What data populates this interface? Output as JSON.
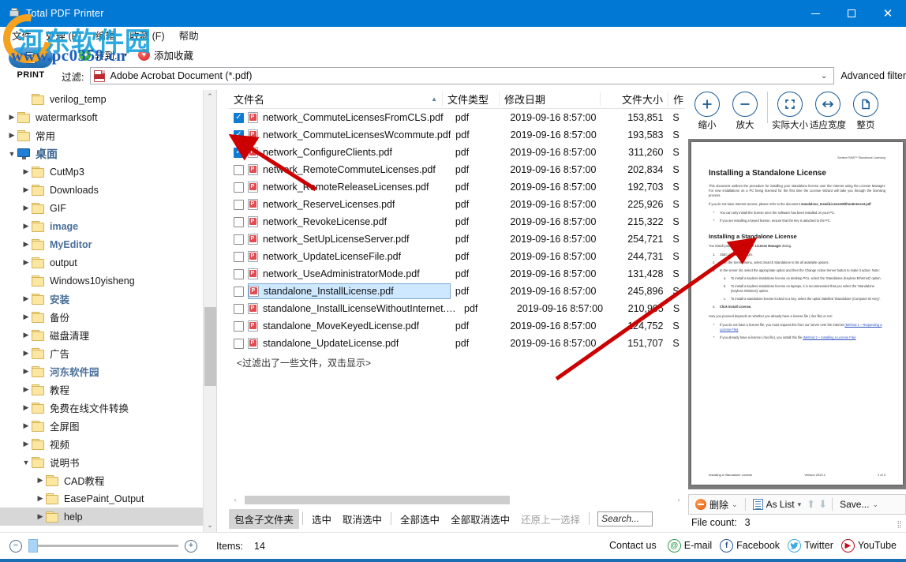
{
  "window": {
    "title": "Total PDF Printer",
    "icon": "printer-icon",
    "minimize": "–",
    "maximize": "□",
    "close": "✕"
  },
  "menubar": {
    "items": [
      {
        "label": "文件"
      },
      {
        "label": "处理 (P)"
      },
      {
        "label": "编辑"
      },
      {
        "label": "收藏 (F)"
      },
      {
        "label": "帮助"
      }
    ]
  },
  "toolbar": {
    "print_label": "PRINT",
    "goto_label": "转到..",
    "goto_caret": "▾",
    "favorite_label": "添加收藏",
    "filter_label": "过滤:",
    "filter_value": "Adobe Acrobat Document (*.pdf)",
    "filter_caret": "⌄",
    "advanced_filter": "Advanced filter"
  },
  "tree": {
    "scroll_up": "⌃",
    "scroll_down": "⌄",
    "items": [
      {
        "label": "verilog_temp",
        "indent": 1,
        "twisty": "",
        "icon": "folder",
        "style": ""
      },
      {
        "label": "watermarksoft",
        "indent": 0,
        "twisty": "▶",
        "icon": "folder",
        "style": ""
      },
      {
        "label": "常用",
        "indent": 0,
        "twisty": "▶",
        "icon": "folder",
        "style": ""
      },
      {
        "label": "桌面",
        "indent": 0,
        "twisty": "▼",
        "icon": "desktop",
        "style": "big"
      },
      {
        "label": "CutMp3",
        "indent": 1,
        "twisty": "▶",
        "icon": "folder",
        "style": ""
      },
      {
        "label": "Downloads",
        "indent": 1,
        "twisty": "▶",
        "icon": "folder",
        "style": ""
      },
      {
        "label": "GIF",
        "indent": 1,
        "twisty": "▶",
        "icon": "folder",
        "style": ""
      },
      {
        "label": "image",
        "indent": 1,
        "twisty": "▶",
        "icon": "folder",
        "style": "blue"
      },
      {
        "label": "MyEditor",
        "indent": 1,
        "twisty": "▶",
        "icon": "folder",
        "style": "blue"
      },
      {
        "label": "output",
        "indent": 1,
        "twisty": "▶",
        "icon": "folder",
        "style": ""
      },
      {
        "label": "Windows10yisheng",
        "indent": 1,
        "twisty": "",
        "icon": "folder",
        "style": ""
      },
      {
        "label": "安装",
        "indent": 1,
        "twisty": "▶",
        "icon": "folder",
        "style": "blue"
      },
      {
        "label": "备份",
        "indent": 1,
        "twisty": "▶",
        "icon": "folder",
        "style": ""
      },
      {
        "label": "磁盘清理",
        "indent": 1,
        "twisty": "▶",
        "icon": "folder",
        "style": ""
      },
      {
        "label": "广告",
        "indent": 1,
        "twisty": "▶",
        "icon": "folder",
        "style": ""
      },
      {
        "label": "河东软件园",
        "indent": 1,
        "twisty": "▶",
        "icon": "folder",
        "style": "blue"
      },
      {
        "label": "教程",
        "indent": 1,
        "twisty": "▶",
        "icon": "folder",
        "style": ""
      },
      {
        "label": "免费在线文件转换",
        "indent": 1,
        "twisty": "▶",
        "icon": "folder",
        "style": ""
      },
      {
        "label": "全屏图",
        "indent": 1,
        "twisty": "▶",
        "icon": "folder",
        "style": ""
      },
      {
        "label": "视频",
        "indent": 1,
        "twisty": "▶",
        "icon": "folder",
        "style": ""
      },
      {
        "label": "说明书",
        "indent": 1,
        "twisty": "▼",
        "icon": "folder",
        "style": ""
      },
      {
        "label": "CAD教程",
        "indent": 2,
        "twisty": "▶",
        "icon": "folder",
        "style": ""
      },
      {
        "label": "EasePaint_Output",
        "indent": 2,
        "twisty": "▶",
        "icon": "folder",
        "style": ""
      },
      {
        "label": "help",
        "indent": 2,
        "twisty": "▶",
        "icon": "folder",
        "style": "",
        "selected": true
      }
    ]
  },
  "filelist": {
    "columns": {
      "name": "文件名",
      "type": "文件类型",
      "date": "修改日期",
      "size": "文件大小",
      "author": "作"
    },
    "sort_indicator": "▲",
    "rows": [
      {
        "checked": true,
        "name": "network_CommuteLicensesFromCLS.pdf",
        "type": "pdf",
        "date": "2019-09-16 8:57:00",
        "size": "153,851",
        "author": "S"
      },
      {
        "checked": true,
        "name": "network_CommuteLicensesWcommute.pdf",
        "type": "pdf",
        "date": "2019-09-16 8:57:00",
        "size": "193,583",
        "author": "S"
      },
      {
        "checked": true,
        "name": "network_ConfigureClients.pdf",
        "type": "pdf",
        "date": "2019-09-16 8:57:00",
        "size": "311,260",
        "author": "S"
      },
      {
        "checked": false,
        "name": "network_RemoteCommuteLicenses.pdf",
        "type": "pdf",
        "date": "2019-09-16 8:57:00",
        "size": "202,834",
        "author": "S"
      },
      {
        "checked": false,
        "name": "network_RemoteReleaseLicenses.pdf",
        "type": "pdf",
        "date": "2019-09-16 8:57:00",
        "size": "192,703",
        "author": "S"
      },
      {
        "checked": false,
        "name": "network_ReserveLicenses.pdf",
        "type": "pdf",
        "date": "2019-09-16 8:57:00",
        "size": "225,926",
        "author": "S"
      },
      {
        "checked": false,
        "name": "network_RevokeLicense.pdf",
        "type": "pdf",
        "date": "2019-09-16 8:57:00",
        "size": "215,322",
        "author": "S"
      },
      {
        "checked": false,
        "name": "network_SetUpLicenseServer.pdf",
        "type": "pdf",
        "date": "2019-09-16 8:57:00",
        "size": "254,721",
        "author": "S"
      },
      {
        "checked": false,
        "name": "network_UpdateLicenseFile.pdf",
        "type": "pdf",
        "date": "2019-09-16 8:57:00",
        "size": "244,731",
        "author": "S"
      },
      {
        "checked": false,
        "name": "network_UseAdministratorMode.pdf",
        "type": "pdf",
        "date": "2019-09-16 8:57:00",
        "size": "131,428",
        "author": "S"
      },
      {
        "checked": false,
        "name": "standalone_InstallLicense.pdf",
        "type": "pdf",
        "date": "2019-09-16 8:57:00",
        "size": "245,896",
        "author": "S",
        "selected": true
      },
      {
        "checked": false,
        "name": "standalone_InstallLicenseWithoutInternet.pdf",
        "type": "pdf",
        "date": "2019-09-16 8:57:00",
        "size": "210,905",
        "author": "S"
      },
      {
        "checked": false,
        "name": "standalone_MoveKeyedLicense.pdf",
        "type": "pdf",
        "date": "2019-09-16 8:57:00",
        "size": "124,752",
        "author": "S"
      },
      {
        "checked": false,
        "name": "standalone_UpdateLicense.pdf",
        "type": "pdf",
        "date": "2019-09-16 8:57:00",
        "size": "151,707",
        "author": "S"
      }
    ],
    "filtered_hint": "<过滤出了一些文件，双击显示>",
    "hscroll_left": "‹",
    "hscroll_right": "›"
  },
  "list_toolbar": {
    "include_subfolders": "包含子文件夹",
    "select": "选中",
    "deselect": "取消选中",
    "select_all": "全部选中",
    "deselect_all": "全部取消选中",
    "restore_prev": "还原上一选择",
    "search_placeholder": "Search..."
  },
  "preview_tools": {
    "buttons": [
      {
        "label": "缩小",
        "icon": "zoom-in-icon",
        "glyph": "+"
      },
      {
        "label": "放大",
        "icon": "zoom-out-icon",
        "glyph": "−"
      },
      {
        "label": "实际大小",
        "icon": "actual-size-icon",
        "glyph": "⛶"
      },
      {
        "label": "适应宽度",
        "icon": "fit-width-icon",
        "glyph": "↔"
      },
      {
        "label": "整页",
        "icon": "fit-page-icon",
        "glyph": "▯"
      }
    ]
  },
  "preview_doc": {
    "header": "Sentinel RMS™ Standalone Licensing",
    "title": "Installing a Standalone License",
    "intro1": "This document outlines the procedure for installing your standalone license over the Internet using the License Manager. For new installations on a PC being licensed for the first time the License Wizard will take you through the licensing process.",
    "intro2_pre": "If you do not have Internet access, please refer to the document ",
    "intro2_bold": "standalone_InstallLicenseWithoutInternet.pdf",
    "bullets": [
      "You can only install the license once the software has been installed on your PC.",
      "If you are installing a keyed license, ensure that the key is attached to the PC."
    ],
    "section2": "Installing a Standalone License",
    "section2_intro_pre": "You install your license from the ",
    "section2_intro_bold": "License Manager",
    "section2_intro_post": " dialog.",
    "steps": [
      {
        "n": "1.",
        "text": "Start License Manager."
      },
      {
        "n": "2.",
        "text": "From the Server menu, select Search Standalone to list all available options."
      },
      {
        "n": "3.",
        "text": "In the server list, select the appropriate option and then the Change Active Server button to make it active. Note:"
      },
      {
        "n": "4.",
        "text": "Click Install License."
      }
    ],
    "substeps": [
      {
        "n": "a.",
        "text": "To install a keyless standalone license on desktop PCs, select the 'Standalone (Keyless Ethernet)' option."
      },
      {
        "n": "b.",
        "text": "To install a keyless standalone license on laptops, it is recommended that you select the 'Standalone (Keyless Wireless)' option."
      },
      {
        "n": "c.",
        "text": "To install a standalone license locked to a key, select the option labelled 'Standalone (Computer ID Key)'."
      }
    ],
    "closing": "How you proceed depends on whether you already have a license file (.rlus file) or not:",
    "closing_bullets": [
      {
        "pre": "If you do not have a license file, you must request this from our server over the Internet ",
        "link": "(Method 1 – Requesting a License File)",
        "post": "."
      },
      {
        "pre": "If you already have a license (.rlus file), you install this file ",
        "link": "(Method 2 – Installing a License File)",
        "post": "."
      }
    ],
    "footer_left": "Installing a Standalone License",
    "footer_mid": "Version 2020.1",
    "footer_right": "1 of 3"
  },
  "preview_bottom": {
    "delete": "删除",
    "delete_caret": "⌄",
    "as_list": "As List",
    "as_list_caret": "▾",
    "move_up": "⬆",
    "move_down": "⬇",
    "save": "Save...",
    "save_caret": "⌄",
    "file_count_label": "File count:",
    "file_count_value": "3"
  },
  "statusbar": {
    "zoom_out": "−",
    "zoom_in": "+",
    "items_label": "Items:",
    "items_value": "14",
    "contact_us": "Contact us",
    "links": [
      {
        "label": "E-mail",
        "icon": "email-icon",
        "glyph": "@",
        "cls": "soc-email"
      },
      {
        "label": "Facebook",
        "icon": "facebook-icon",
        "glyph": "f",
        "cls": "soc-fb"
      },
      {
        "label": "Twitter",
        "icon": "twitter-icon",
        "glyph": "🐦",
        "cls": "soc-tw"
      },
      {
        "label": "YouTube",
        "icon": "youtube-icon",
        "glyph": "▶",
        "cls": "soc-yt"
      }
    ]
  },
  "watermark": {
    "cn": "河东软件园",
    "url": "www.pc0359.cn"
  },
  "colors": {
    "titlebar": "#0078d4",
    "accent": "#1a5c96",
    "checkbox_on": "#0c7cd5",
    "selection": "#cde8ff",
    "annotation": "#cc0000"
  }
}
